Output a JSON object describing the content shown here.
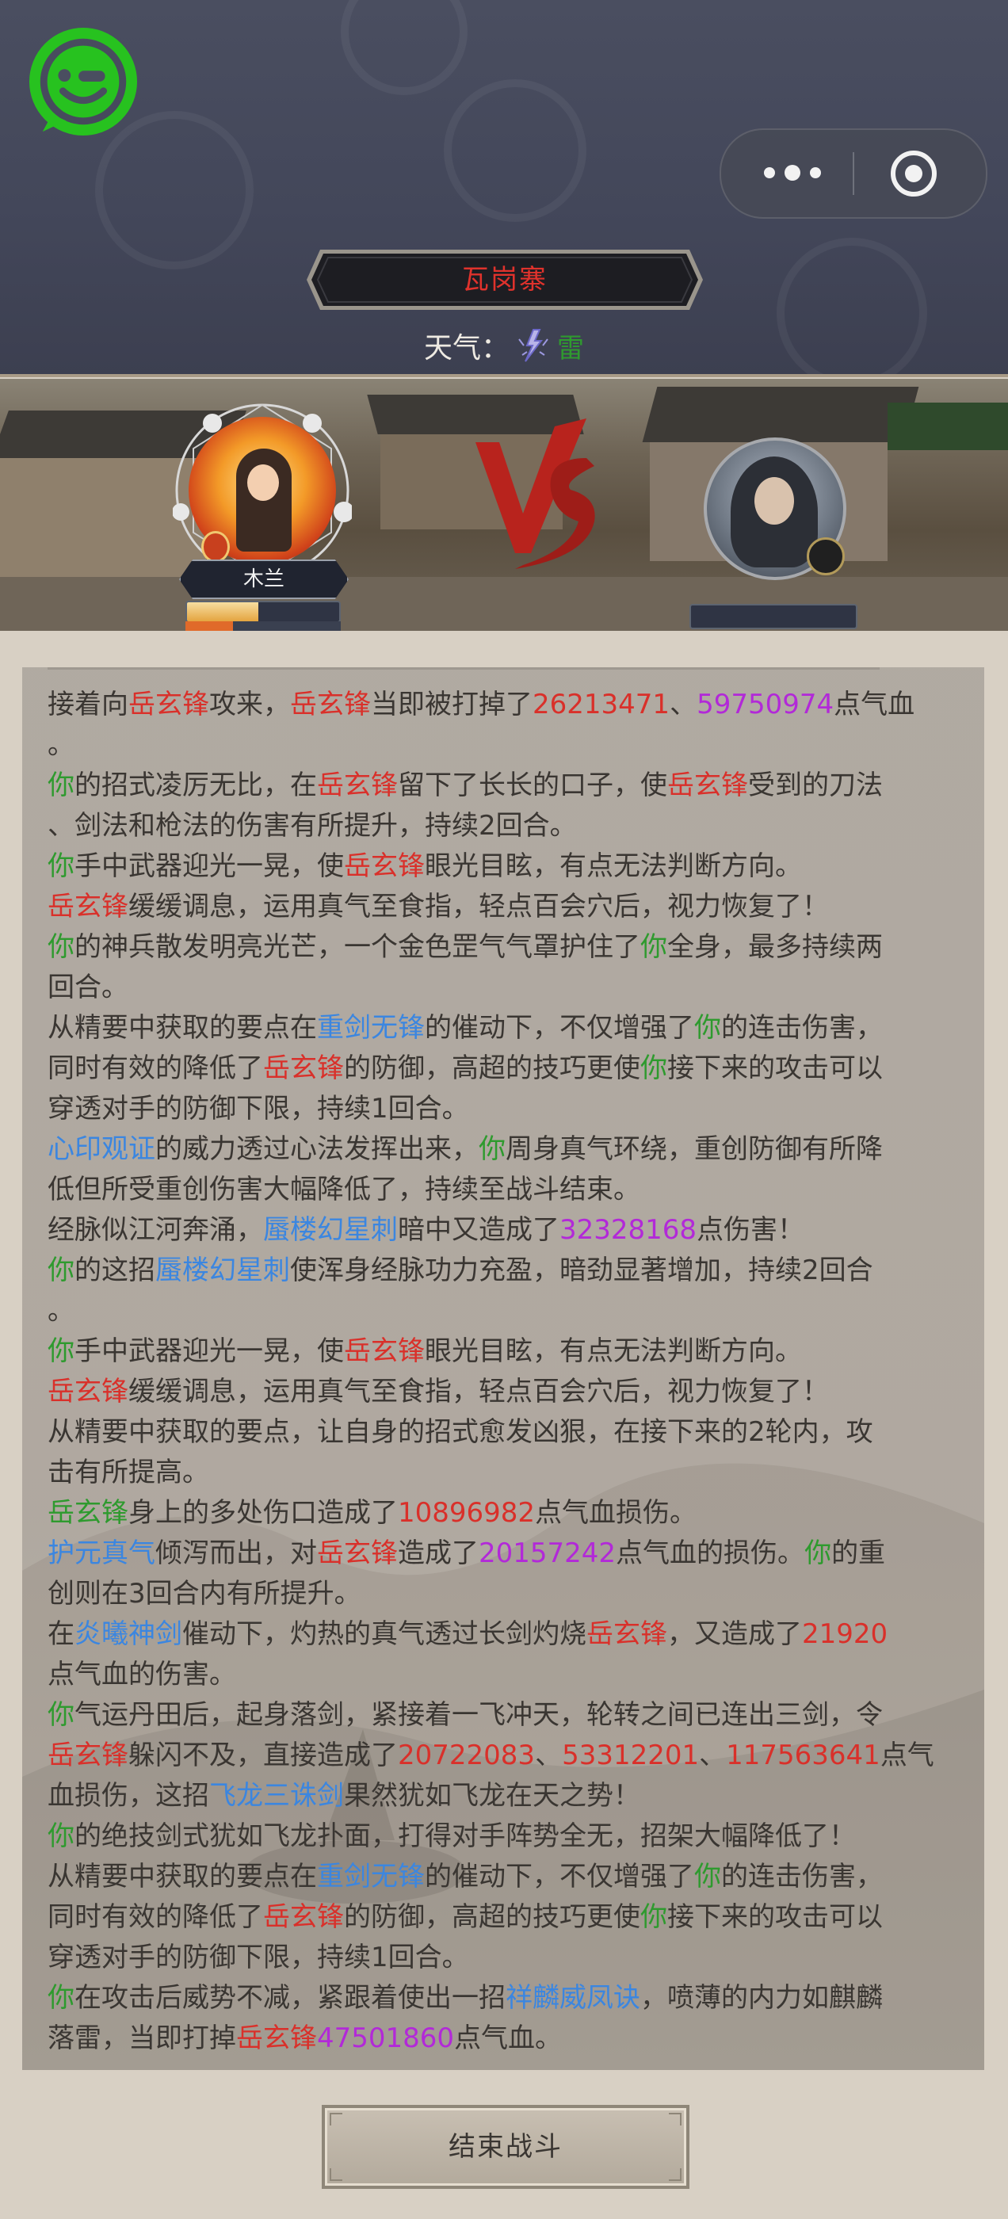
{
  "header": {
    "location": "瓦岗寨",
    "weather_label": "天气：",
    "weather_value": "雷",
    "weather_icon": "lightning-icon"
  },
  "capsule": {
    "more_icon": "more-dots-icon",
    "close_icon": "target-close-icon"
  },
  "battle": {
    "player_name": "木兰",
    "player_hp_fraction": 0.47,
    "enemy_hp_fraction": 0,
    "vs_icon": "vs-emblem"
  },
  "log": {
    "lines": [
      [
        [
          "接着向",
          ""
        ],
        [
          "岳玄锋",
          "red"
        ],
        [
          "攻来，",
          ""
        ],
        [
          "岳玄锋",
          "red"
        ],
        [
          "当即被打掉了",
          ""
        ],
        [
          "26213471",
          "red"
        ],
        [
          "、",
          ""
        ],
        [
          "59750974",
          "purple"
        ],
        [
          "点气血",
          ""
        ]
      ],
      [
        [
          "。",
          ""
        ]
      ],
      [
        [
          "你",
          "green"
        ],
        [
          "的招式凌厉无比，在",
          ""
        ],
        [
          "岳玄锋",
          "red"
        ],
        [
          "留下了长长的口子，使",
          ""
        ],
        [
          "岳玄锋",
          "red"
        ],
        [
          "受到的刀法",
          ""
        ]
      ],
      [
        [
          "、剑法和枪法的伤害有所提升，持续2回合。",
          ""
        ]
      ],
      [
        [
          "你",
          "green"
        ],
        [
          "手中武器迎光一晃，使",
          ""
        ],
        [
          "岳玄锋",
          "red"
        ],
        [
          "眼光目眩，有点无法判断方向。",
          ""
        ]
      ],
      [
        [
          "岳玄锋",
          "red"
        ],
        [
          "缓缓调息，运用真气至食指，轻点百会穴后，视力恢复了！",
          ""
        ]
      ],
      [
        [
          "你",
          "green"
        ],
        [
          "的神兵散发明亮光芒，一个金色罡气气罩护住了",
          ""
        ],
        [
          "你",
          "green"
        ],
        [
          "全身，最多持续两",
          ""
        ]
      ],
      [
        [
          "回合。",
          ""
        ]
      ],
      [
        [
          "从精要中获取的要点在",
          ""
        ],
        [
          "重剑无锋",
          "blue"
        ],
        [
          "的催动下，不仅增强了",
          ""
        ],
        [
          "你",
          "green"
        ],
        [
          "的连击伤害，",
          ""
        ]
      ],
      [
        [
          "同时有效的降低了",
          ""
        ],
        [
          "岳玄锋",
          "red"
        ],
        [
          "的防御，高超的技巧更使",
          ""
        ],
        [
          "你",
          "green"
        ],
        [
          "接下来的攻击可以",
          ""
        ]
      ],
      [
        [
          "穿透对手的防御下限，持续1回合。",
          ""
        ]
      ],
      [
        [
          "心印观证",
          "blue"
        ],
        [
          "的威力透过心法发挥出来，",
          ""
        ],
        [
          "你",
          "green"
        ],
        [
          "周身真气环绕，重创防御有所降",
          ""
        ]
      ],
      [
        [
          "低但所受重创伤害大幅降低了，持续至战斗结束。",
          ""
        ]
      ],
      [
        [
          "经脉似江河奔涌，",
          ""
        ],
        [
          "蜃楼幻星刺",
          "blue"
        ],
        [
          "暗中又造成了",
          ""
        ],
        [
          "32328168",
          "purple"
        ],
        [
          "点伤害！",
          ""
        ]
      ],
      [
        [
          "你",
          "green"
        ],
        [
          "的这招",
          ""
        ],
        [
          "蜃楼幻星刺",
          "blue"
        ],
        [
          "使浑身经脉功力充盈，暗劲显著增加，持续2回合",
          ""
        ]
      ],
      [
        [
          "。",
          ""
        ]
      ],
      [
        [
          "你",
          "green"
        ],
        [
          "手中武器迎光一晃，使",
          ""
        ],
        [
          "岳玄锋",
          "red"
        ],
        [
          "眼光目眩，有点无法判断方向。",
          ""
        ]
      ],
      [
        [
          "岳玄锋",
          "red"
        ],
        [
          "缓缓调息，运用真气至食指，轻点百会穴后，视力恢复了！",
          ""
        ]
      ],
      [
        [
          "从精要中获取的要点，让自身的招式愈发凶狠，在接下来的2轮内，攻",
          ""
        ]
      ],
      [
        [
          "击有所提高。",
          ""
        ]
      ],
      [
        [
          "岳玄锋",
          "green"
        ],
        [
          "身上的多处伤口造成了",
          ""
        ],
        [
          "10896982",
          "red"
        ],
        [
          "点气血损伤。",
          ""
        ]
      ],
      [
        [
          "护元真气",
          "blue"
        ],
        [
          "倾泻而出，对",
          ""
        ],
        [
          "岳玄锋",
          "red"
        ],
        [
          "造成了",
          ""
        ],
        [
          "20157242",
          "purple"
        ],
        [
          "点气血的损伤。",
          ""
        ],
        [
          "你",
          "green"
        ],
        [
          "的重",
          ""
        ]
      ],
      [
        [
          "创则在3回合内有所提升。",
          ""
        ]
      ],
      [
        [
          "在",
          ""
        ],
        [
          "炎曦神剑",
          "blue"
        ],
        [
          "催动下，灼热的真气透过长剑灼烧",
          ""
        ],
        [
          "岳玄锋",
          "red"
        ],
        [
          "，又造成了",
          ""
        ],
        [
          "21920",
          "red"
        ]
      ],
      [
        [
          "点气血的伤害。",
          ""
        ]
      ],
      [
        [
          "你",
          "green"
        ],
        [
          "气运丹田后，起身落剑，紧接着一飞冲天，轮转之间已连出三剑，令",
          ""
        ]
      ],
      [
        [
          "岳玄锋",
          "red"
        ],
        [
          "躲闪不及，直接造成了",
          ""
        ],
        [
          "20722083",
          "red"
        ],
        [
          "、",
          ""
        ],
        [
          "53312201",
          "red"
        ],
        [
          "、",
          ""
        ],
        [
          "117563641",
          "red"
        ],
        [
          "点气",
          ""
        ]
      ],
      [
        [
          "血损伤，这招",
          ""
        ],
        [
          "飞龙三诛剑",
          "blue"
        ],
        [
          "果然犹如飞龙在天之势！",
          ""
        ]
      ],
      [
        [
          "你",
          "green"
        ],
        [
          "的绝技剑式犹如飞龙扑面，打得对手阵势全无，招架大幅降低了！",
          ""
        ]
      ],
      [
        [
          "从精要中获取的要点在",
          ""
        ],
        [
          "重剑无锋",
          "blue"
        ],
        [
          "的催动下，不仅增强了",
          ""
        ],
        [
          "你",
          "green"
        ],
        [
          "的连击伤害，",
          ""
        ]
      ],
      [
        [
          "同时有效的降低了",
          ""
        ],
        [
          "岳玄锋",
          "red"
        ],
        [
          "的防御，高超的技巧更使",
          ""
        ],
        [
          "你",
          "green"
        ],
        [
          "接下来的攻击可以",
          ""
        ]
      ],
      [
        [
          "穿透对手的防御下限，持续1回合。",
          ""
        ]
      ],
      [
        [
          "你",
          "green"
        ],
        [
          "在攻击后威势不减，紧跟着使出一招",
          ""
        ],
        [
          "祥麟威凤诀",
          "blue"
        ],
        [
          "，喷薄的内力如麒麟",
          ""
        ]
      ],
      [
        [
          "落雷，当即打掉",
          ""
        ],
        [
          "岳玄锋",
          "red"
        ],
        [
          "47501860",
          "purple"
        ],
        [
          "点气血。",
          ""
        ]
      ]
    ]
  },
  "footer": {
    "end_button_label": "结束战斗"
  },
  "colors": {
    "red": "#d9302a",
    "green": "#2e9a2e",
    "blue": "#3b86e0",
    "purple": "#b229d8",
    "location_red": "#e0322c"
  }
}
